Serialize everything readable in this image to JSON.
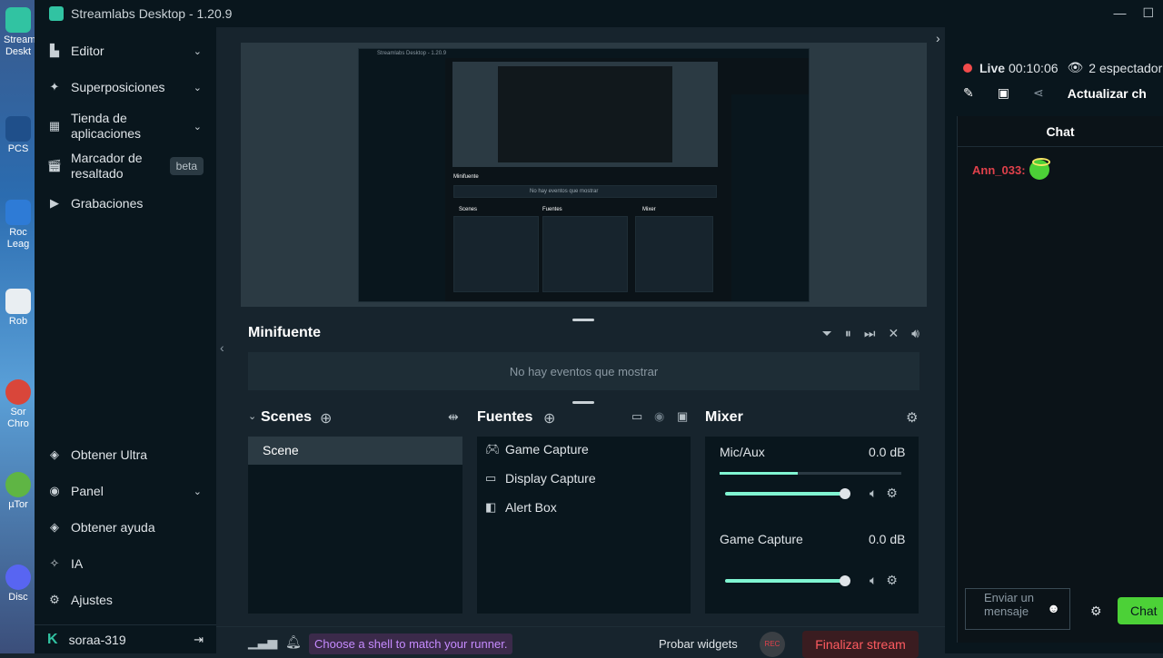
{
  "window": {
    "title": "Streamlabs Desktop - 1.20.9",
    "controls": [
      "—",
      "☐"
    ]
  },
  "desktop_icons": [
    {
      "label": "Stream\nDeskt"
    },
    {
      "label": "PCS"
    },
    {
      "label": "Roc\nLeag"
    },
    {
      "label": "Rob"
    },
    {
      "label": "Sor\nChro"
    },
    {
      "label": "µTor"
    },
    {
      "label": "Disc"
    }
  ],
  "sidebar": {
    "items": [
      {
        "label": "Editor",
        "icon": "editor-icon"
      },
      {
        "label": "Superposiciones",
        "icon": "overlays-icon"
      },
      {
        "label": "Tienda de aplicaciones",
        "icon": "app-store-icon"
      },
      {
        "label": "Marcador de resaltado",
        "icon": "highlighter-icon",
        "badge": "beta"
      },
      {
        "label": "Grabaciones",
        "icon": "recordings-icon"
      }
    ],
    "bottom_items": [
      {
        "label": "Obtener Ultra",
        "icon": "ultra-icon"
      },
      {
        "label": "Panel",
        "icon": "dashboard-icon"
      },
      {
        "label": "Obtener ayuda",
        "icon": "help-icon"
      },
      {
        "label": "IA",
        "icon": "ai-sparkle-icon"
      },
      {
        "label": "Ajustes",
        "icon": "gear-icon"
      }
    ],
    "user": {
      "name": "soraa-319",
      "logo": "K"
    }
  },
  "preview": {
    "nested_title": "Streamlabs Desktop - 1.20.9",
    "nested_minifeed": "Minifuente",
    "nested_empty": "No hay eventos que mostrar",
    "nested_scenes": "Scenes",
    "nested_sources": "Fuentes",
    "nested_mixer": "Mixer"
  },
  "minifeed": {
    "title": "Minifuente",
    "empty": "No hay eventos que mostrar"
  },
  "scenes": {
    "title": "Scenes",
    "items": [
      "Scene"
    ]
  },
  "sources": {
    "title": "Fuentes",
    "items": [
      {
        "label": "Game Capture",
        "icon": "gamepad-icon"
      },
      {
        "label": "Display Capture",
        "icon": "monitor-icon"
      },
      {
        "label": "Alert Box",
        "icon": "alert-box-icon"
      }
    ]
  },
  "mixer": {
    "title": "Mixer",
    "channels": [
      {
        "name": "Mic/Aux",
        "db": "0.0 dB",
        "level": 0.43,
        "volume": 1.0
      },
      {
        "name": "Game Capture",
        "db": "0.0 dB",
        "level": 0.0,
        "volume": 1.0
      }
    ]
  },
  "footer": {
    "notification": "Choose a shell to match your runner.",
    "test_widgets": "Probar widgets",
    "rec": "REC",
    "end_stream": "Finalizar stream"
  },
  "right_panel": {
    "live_label": "Live",
    "live_time": "00:10:06",
    "viewers": "2 espectador",
    "update_label": "Actualizar ch",
    "chat_title": "Chat",
    "messages": [
      {
        "user": "Ann_033",
        "text": ":"
      }
    ],
    "input_placeholder": "Enviar un mensaje",
    "send_label": "Chat"
  },
  "colors": {
    "accent": "#31c3a2",
    "live": "#f24b4b",
    "send_button": "#4cd137",
    "end_stream": "#ff5b60"
  }
}
